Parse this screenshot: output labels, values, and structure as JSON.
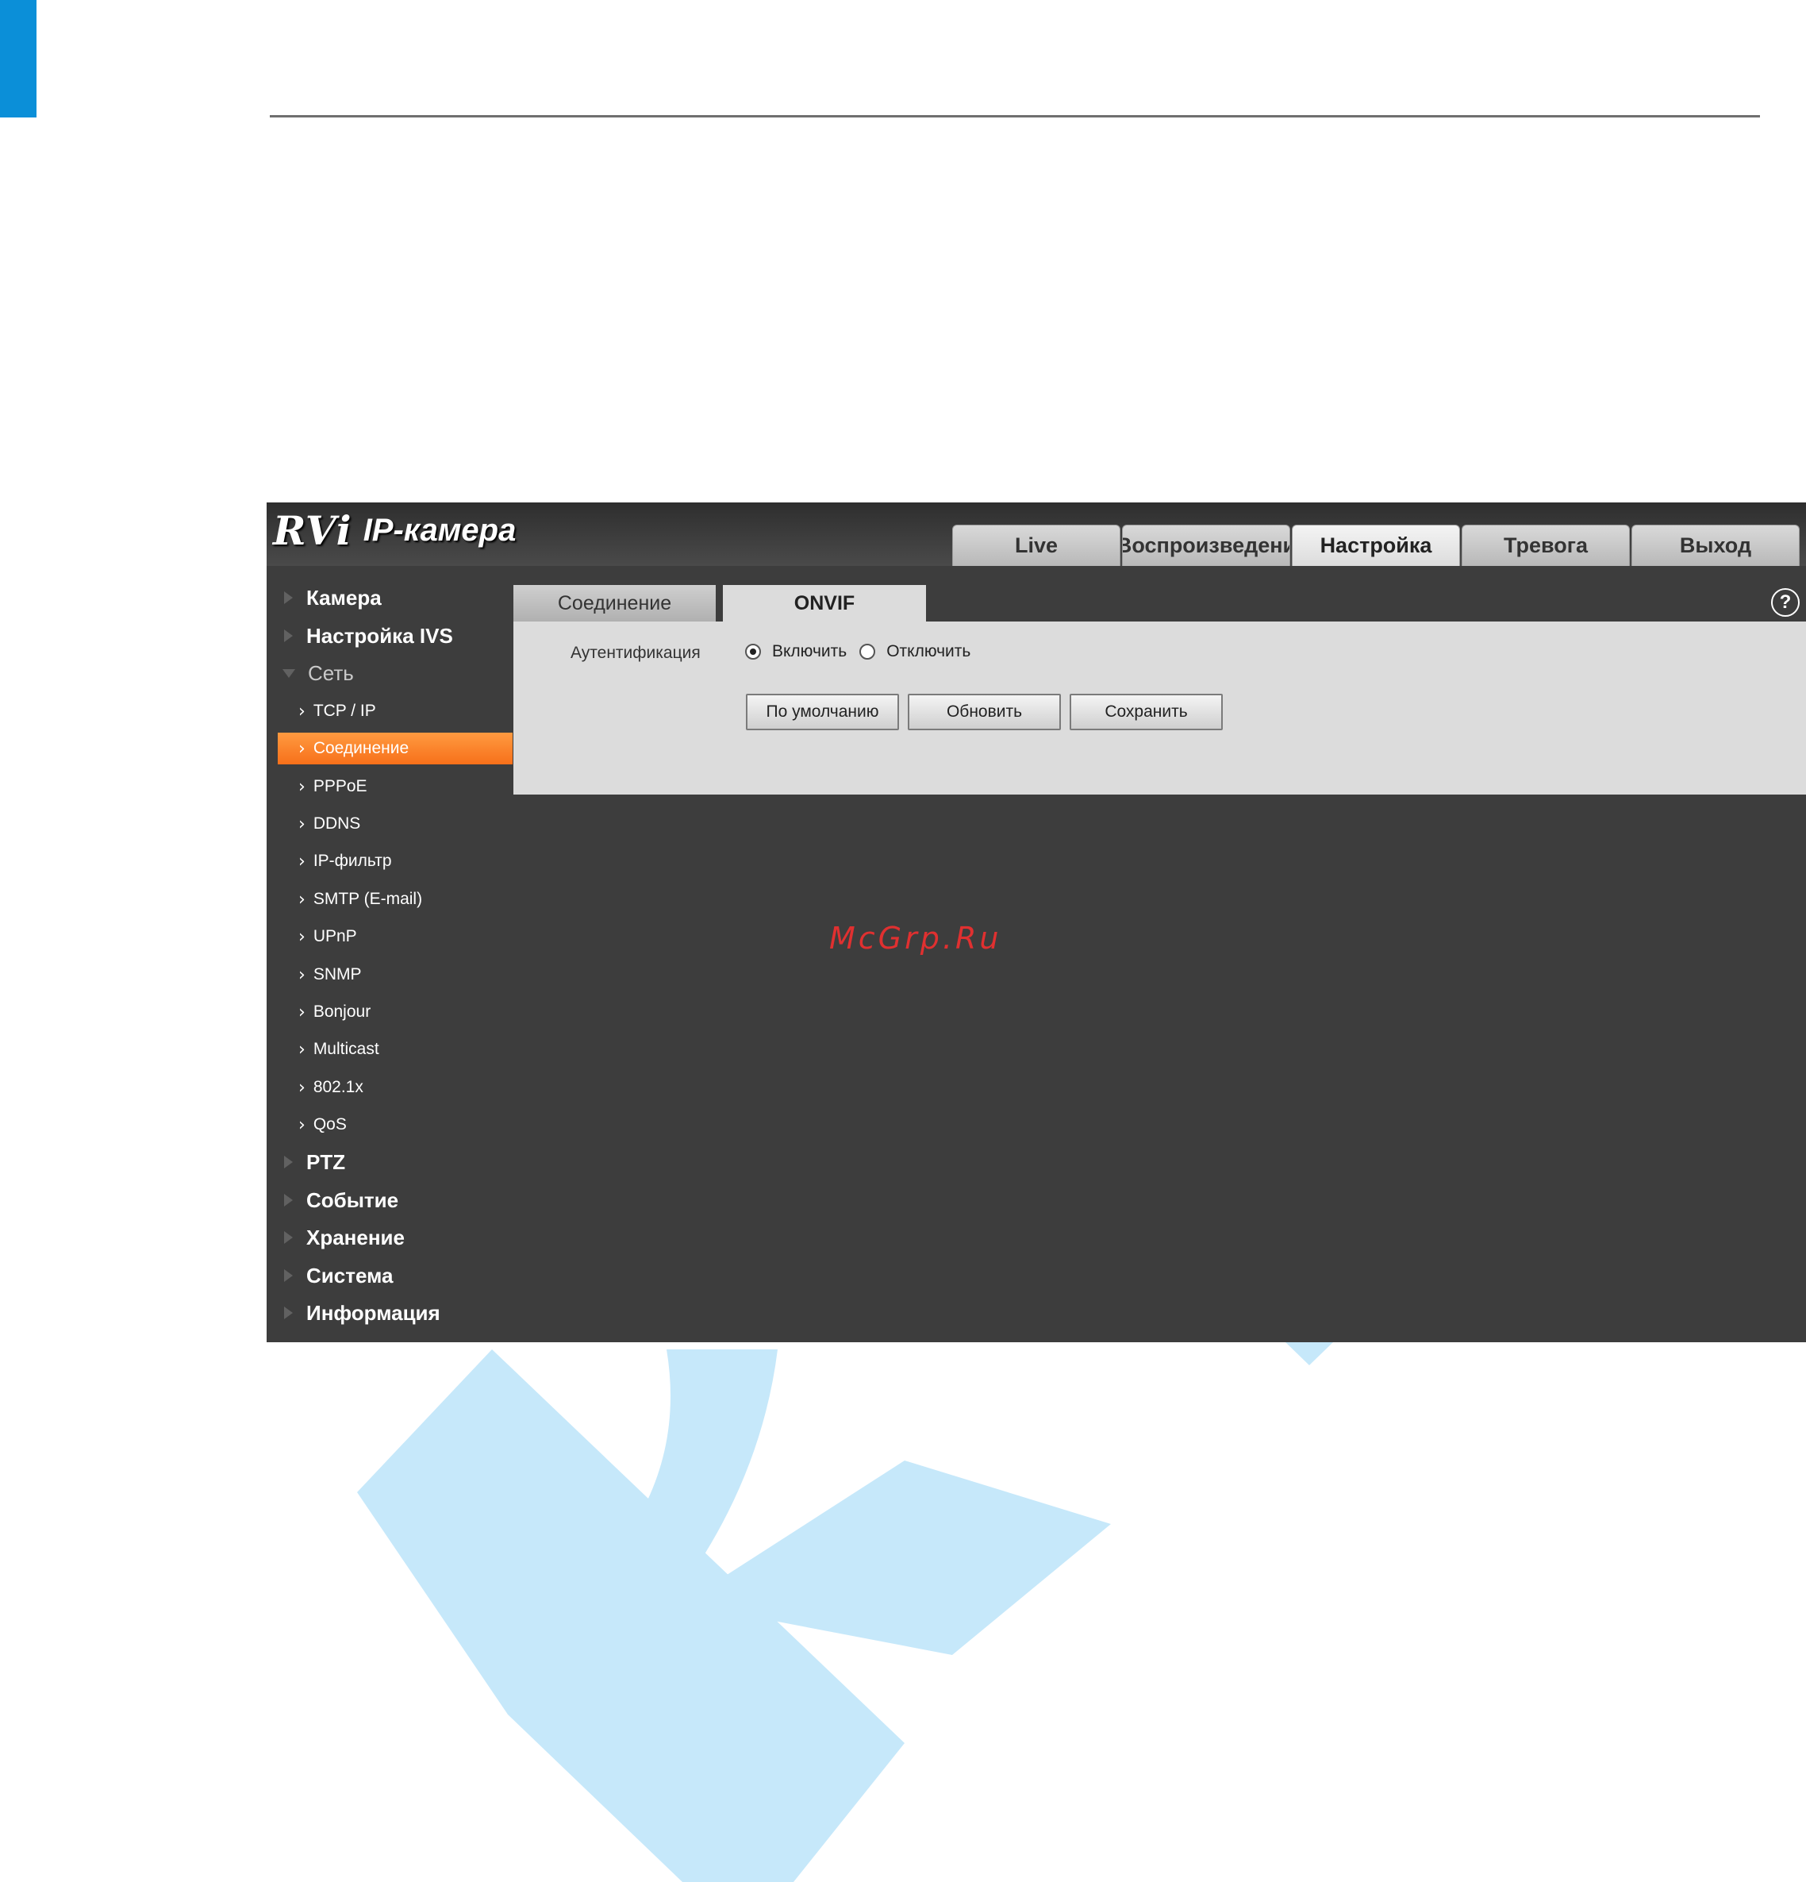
{
  "colors": {
    "accent_blue": "#0b8fd8",
    "active_orange": "#f7701a",
    "sidebar_bg": "#3d3d3d",
    "panel_bg": "#dcdcdc",
    "watermark": "#c6e8fa",
    "watermark_text": "#e03030"
  },
  "app": {
    "brand": "RVi",
    "title": "IP-камера"
  },
  "nav_tabs": [
    {
      "label": "Live"
    },
    {
      "label": "Воспроизведени"
    },
    {
      "label": "Настройка",
      "active": true
    },
    {
      "label": "Тревога"
    },
    {
      "label": "Выход"
    }
  ],
  "sidebar": {
    "camera": "Камера",
    "ivs": "Настройка IVS",
    "network": "Сеть",
    "tcpip": "TCP / IP",
    "connection": "Соединение",
    "pppoe": "PPPoE",
    "ddns": "DDNS",
    "ipfilter": "IP-фильтр",
    "smtp": "SMTP (E-mail)",
    "upnp": "UPnP",
    "snmp": "SNMP",
    "bonjour": "Bonjour",
    "multicast": "Multicast",
    "dot1x": "802.1x",
    "qos": "QoS",
    "ptz": "PTZ",
    "event": "Событие",
    "storage": "Хранение",
    "system": "Система",
    "info": "Информация"
  },
  "sub_tabs": {
    "connection": "Соединение",
    "onvif": "ONVIF"
  },
  "help_icon": "question-icon",
  "form": {
    "auth_label": "Аутентификация",
    "enable_label": "Включить",
    "disable_label": "Отключить",
    "auth_value": "enable"
  },
  "buttons": {
    "default": "По умолчанию",
    "refresh": "Обновить",
    "save": "Сохранить"
  },
  "watermark_text": "McGrp.Ru"
}
